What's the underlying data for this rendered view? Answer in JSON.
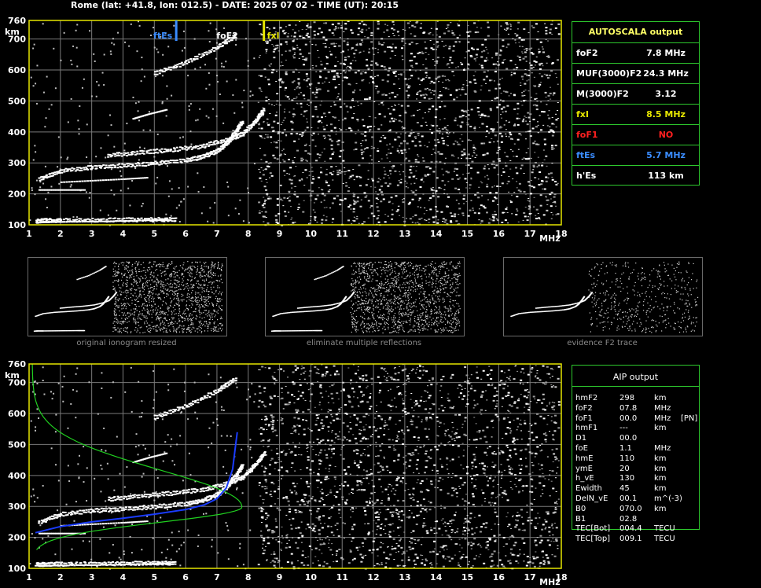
{
  "header": {
    "title": "Rome (lat: +41.8, lon: 012.5) - DATE: 2025 07 02 - TIME (UT): 20:15"
  },
  "axes": {
    "y_unit": "km",
    "x_unit": "MHz",
    "y_ticks": [
      "760",
      "700",
      "600",
      "500",
      "400",
      "300",
      "200",
      "100"
    ],
    "x_ticks": [
      "1",
      "2",
      "3",
      "4",
      "5",
      "6",
      "7",
      "8",
      "9",
      "10",
      "11",
      "12",
      "13",
      "14",
      "15",
      "16",
      "17",
      "18"
    ]
  },
  "markers": {
    "ftEs": "ftEs",
    "foF2": "foF2",
    "fxI": "fxI"
  },
  "autoscala": {
    "title": "AUTOSCALA output",
    "rows": [
      {
        "label": "foF2",
        "value": "7.8 MHz",
        "color": "#ffffff"
      },
      {
        "label": "MUF(3000)F2",
        "value": "24.3 MHz",
        "color": "#ffffff"
      },
      {
        "label": "M(3000)F2",
        "value": "3.12",
        "color": "#ffffff"
      },
      {
        "label": "fxI",
        "value": "8.5 MHz",
        "color": "#e6e600"
      },
      {
        "label": "foF1",
        "value": "NO",
        "color": "#ff2020"
      },
      {
        "label": "ftEs",
        "value": "5.7 MHz",
        "color": "#3a8cff"
      },
      {
        "label": "h'Es",
        "value": "113    km",
        "color": "#ffffff"
      }
    ]
  },
  "thumbs": {
    "captions": [
      "original ionogram resized",
      "eliminate multiple reflections",
      "evidence F2 trace"
    ]
  },
  "aip": {
    "title": "AIP output",
    "rows": [
      {
        "name": "hmF2",
        "value": "298",
        "unit": "km",
        "extra": ""
      },
      {
        "name": "foF2",
        "value": "07.8",
        "unit": "MHz",
        "extra": ""
      },
      {
        "name": "foF1",
        "value": "00.0",
        "unit": "MHz",
        "extra": "[PN]"
      },
      {
        "name": "hmF1",
        "value": "---",
        "unit": "km",
        "extra": ""
      },
      {
        "name": "D1",
        "value": "00.0",
        "unit": "",
        "extra": ""
      },
      {
        "name": "foE",
        "value": "1.1",
        "unit": "MHz",
        "extra": ""
      },
      {
        "name": "hmE",
        "value": "110",
        "unit": "km",
        "extra": ""
      },
      {
        "name": "ymE",
        "value": "20",
        "unit": "km",
        "extra": ""
      },
      {
        "name": "h_vE",
        "value": "130",
        "unit": "km",
        "extra": ""
      },
      {
        "name": "Ewidth",
        "value": "45",
        "unit": "km",
        "extra": ""
      },
      {
        "name": "DelN_vE",
        "value": "00.1",
        "unit": "m^(-3)",
        "extra": ""
      },
      {
        "name": "B0",
        "value": "070.0",
        "unit": "km",
        "extra": ""
      },
      {
        "name": "B1",
        "value": "02.8",
        "unit": "",
        "extra": ""
      },
      {
        "name": "TEC[Bot]",
        "value": "004.4",
        "unit": "TECU",
        "extra": ""
      },
      {
        "name": "TEC[Top]",
        "value": "009.1",
        "unit": "TECU",
        "extra": ""
      }
    ]
  },
  "colors": {
    "frame": "#e6e600",
    "table_border": "#2dc82d",
    "es": "#3a8cff",
    "profile": "#20d020",
    "trace": "#1a3cff"
  },
  "chart_data": [
    {
      "type": "scatter",
      "title": "Rome (lat: +41.8, lon: 012.5) - DATE: 2025 07 02 - TIME (UT): 20:15",
      "xlabel": "MHz",
      "ylabel": "km",
      "xlim": [
        1,
        18
      ],
      "ylim": [
        100,
        760
      ],
      "grid": true,
      "markers": [
        {
          "name": "ftEs",
          "x": 5.7
        },
        {
          "name": "foF2",
          "x": 7.8
        },
        {
          "name": "fxI",
          "x": 8.5
        }
      ],
      "series": [
        {
          "name": "Es",
          "points": [
            [
              1.2,
              118
            ],
            [
              1.5,
              120
            ],
            [
              2,
              120
            ],
            [
              3,
              121
            ],
            [
              4,
              122
            ],
            [
              5,
              123
            ],
            [
              5.7,
              123
            ]
          ]
        },
        {
          "name": "F2-O",
          "points": [
            [
              1.3,
              255
            ],
            [
              2,
              280
            ],
            [
              3,
              292
            ],
            [
              4,
              298
            ],
            [
              5,
              305
            ],
            [
              6,
              315
            ],
            [
              6.5,
              325
            ],
            [
              7,
              345
            ],
            [
              7.3,
              370
            ],
            [
              7.6,
              410
            ],
            [
              7.8,
              440
            ]
          ]
        },
        {
          "name": "F2-X",
          "points": [
            [
              3.5,
              330
            ],
            [
              4.5,
              340
            ],
            [
              5.5,
              348
            ],
            [
              6.5,
              360
            ],
            [
              7.3,
              380
            ],
            [
              7.8,
              400
            ],
            [
              8.2,
              440
            ],
            [
              8.5,
              480
            ]
          ]
        },
        {
          "name": "F2-multiple",
          "points": [
            [
              5,
              595
            ],
            [
              6,
              630
            ],
            [
              7,
              680
            ],
            [
              7.6,
              720
            ]
          ]
        }
      ]
    }
  ]
}
